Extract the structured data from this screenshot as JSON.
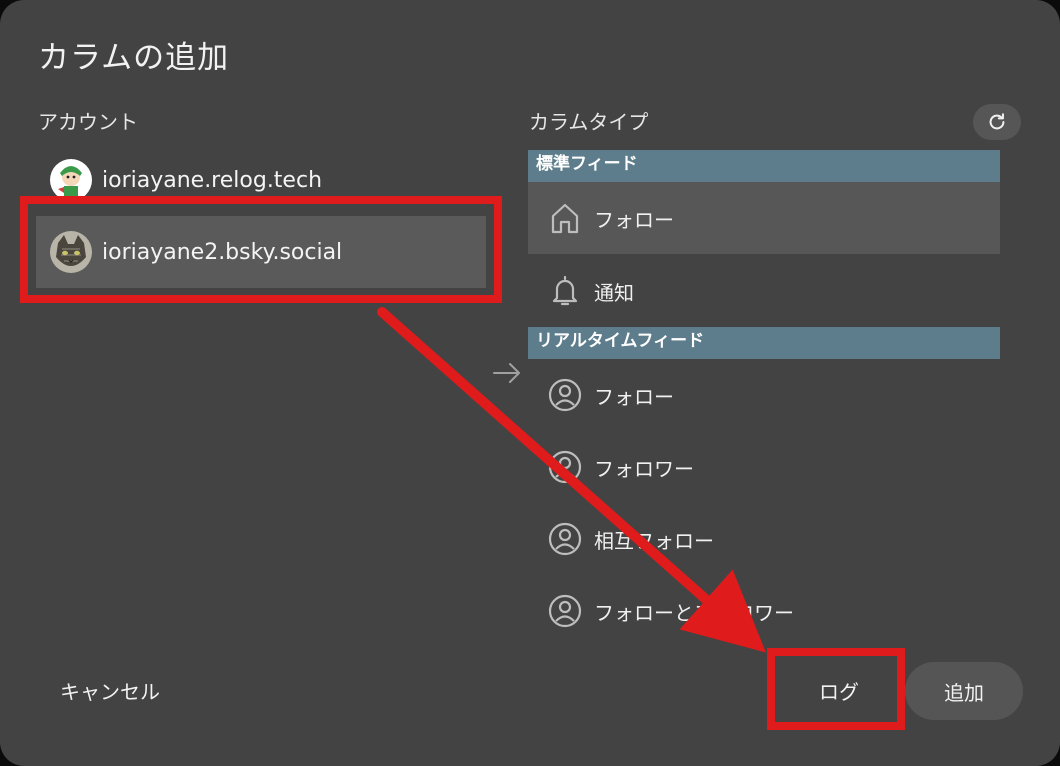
{
  "dialog": {
    "title": "カラムの追加"
  },
  "accounts": {
    "label": "アカウント",
    "items": [
      {
        "handle": "ioriayane.relog.tech",
        "avatar": "avatar-cartoon",
        "selected": false
      },
      {
        "handle": "ioriayane2.bsky.social",
        "avatar": "avatar-cat",
        "selected": true
      }
    ]
  },
  "column_types": {
    "label": "カラムタイプ",
    "refresh_icon": "refresh-icon",
    "groups": [
      {
        "header": "標準フィード",
        "items": [
          {
            "label": "フォロー",
            "icon": "home-icon",
            "selected": true
          },
          {
            "label": "通知",
            "icon": "bell-icon",
            "selected": false
          }
        ]
      },
      {
        "header": "リアルタイムフィード",
        "items": [
          {
            "label": "フォロー",
            "icon": "user-circle-icon",
            "selected": false
          },
          {
            "label": "フォロワー",
            "icon": "user-circle-icon",
            "selected": false
          },
          {
            "label": "相互フォロー",
            "icon": "user-circle-icon",
            "selected": false
          },
          {
            "label": "フォローとフォロワー",
            "icon": "user-circle-icon",
            "selected": false
          }
        ]
      }
    ]
  },
  "footer": {
    "cancel_label": "キャンセル",
    "login_label": "ログ",
    "add_label": "追加"
  },
  "annotation": {
    "highlight_color": "#e01b1b",
    "accent_header_color": "#5e7d8c"
  }
}
